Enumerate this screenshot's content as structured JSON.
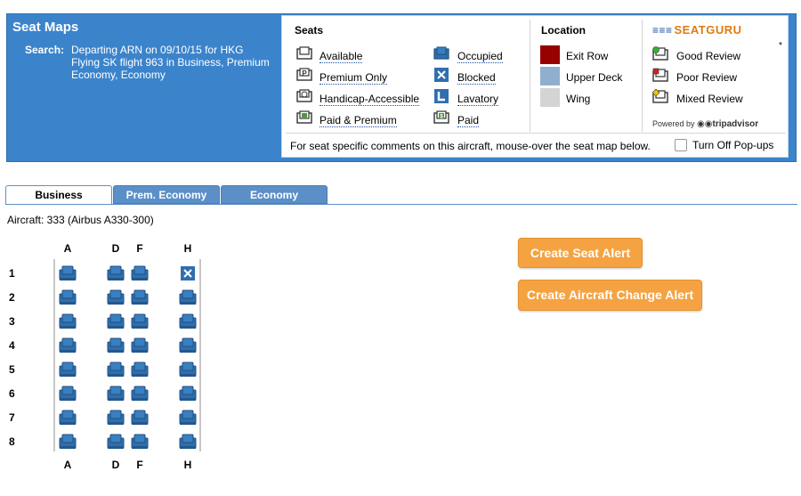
{
  "header": {
    "title": "Seat Maps",
    "search_label": "Search:",
    "search_text": "Departing ARN on 09/10/15 for HKG Flying SK flight 963 in Business, Premium Economy, Economy"
  },
  "legend": {
    "seats_heading": "Seats",
    "location_heading": "Location",
    "seats_col1": [
      {
        "label": "Available",
        "icon": "seat-available-icon"
      },
      {
        "label": "Premium Only",
        "icon": "premium-only-icon"
      },
      {
        "label": "Handicap-Accessible",
        "icon": "handicap-icon"
      },
      {
        "label": "Paid & Premium",
        "icon": "paid-premium-icon"
      }
    ],
    "seats_col2": [
      {
        "label": "Occupied",
        "icon": "seat-occupied-icon"
      },
      {
        "label": "Blocked",
        "icon": "seat-blocked-icon"
      },
      {
        "label": "Lavatory",
        "icon": "lavatory-icon"
      },
      {
        "label": "Paid",
        "icon": "paid-icon"
      }
    ],
    "location": [
      {
        "label": "Exit Row",
        "color": "#990000"
      },
      {
        "label": "Upper Deck",
        "color": "#8fb0cc"
      },
      {
        "label": "Wing",
        "color": "#d4d4d4"
      }
    ],
    "logo_text": "SEATGURU",
    "reviews": [
      {
        "label": "Good Review",
        "color": "#2fb52f"
      },
      {
        "label": "Poor Review",
        "color": "#d42020"
      },
      {
        "label": "Mixed Review",
        "color": "#f2c400"
      }
    ],
    "asterisk": "*",
    "powered_prefix": "Powered by",
    "powered_brand": "tripadvisor",
    "footer_text": "For seat specific comments on this aircraft, mouse-over the seat map below.",
    "popups_label": "Turn Off Pop-ups"
  },
  "tabs": [
    {
      "label": "Business",
      "active": true
    },
    {
      "label": "Prem. Economy",
      "active": false
    },
    {
      "label": "Economy",
      "active": false
    }
  ],
  "aircraft": "Aircraft: 333 (Airbus A330-300)",
  "seatmap": {
    "columns": [
      "A",
      "D",
      "F",
      "H"
    ],
    "rows": [
      "1",
      "2",
      "3",
      "4",
      "5",
      "6",
      "7",
      "8"
    ],
    "blocked_seats": [
      "1H"
    ]
  },
  "buttons": {
    "seat_alert": "Create Seat Alert",
    "aircraft_alert": "Create Aircraft Change Alert"
  },
  "colors": {
    "header_blue": "#3b84cc",
    "seat_blue": "#2f6fb0",
    "button_orange": "#f5a342"
  }
}
